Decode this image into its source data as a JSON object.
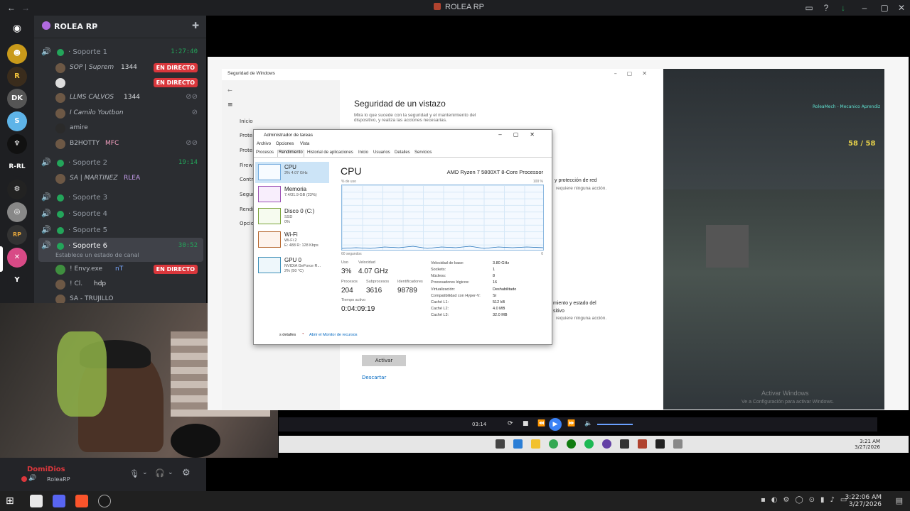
{
  "app": {
    "title": "ROLEA RP"
  },
  "server": {
    "name": "ROLEA RP"
  },
  "channels": [
    {
      "name": "Soporte",
      "sub": "1",
      "time": "1:27:40"
    },
    {
      "name": "Soporte",
      "sub": "2",
      "time": "19:14"
    },
    {
      "name": "Soporte",
      "sub": "3"
    },
    {
      "name": "Soporte",
      "sub": "4"
    },
    {
      "name": "Soporte",
      "sub": "5"
    },
    {
      "name": "Soporte",
      "sub": "6",
      "time": "30:52",
      "status_placeholder": "Establece un estado de canal"
    }
  ],
  "members": [
    {
      "name": "SOP | Suprem",
      "badge": "1344",
      "live": "EN DIRECTO"
    },
    {
      "name": "",
      "live": "EN DIRECTO"
    },
    {
      "name": "LLMS CALVOS",
      "badge": "1344"
    },
    {
      "name": "I Camilo Youtbon"
    },
    {
      "name": "amire"
    },
    {
      "name": "B2HOTTY",
      "badge": "MFC"
    },
    {
      "name": "SA | MARTINEZ",
      "badge": "RLEA"
    },
    {
      "name": "! Envy.exe",
      "badge": "nT",
      "live": "EN DIRECTO"
    },
    {
      "name": "! Cl.",
      "badge": "hdp"
    },
    {
      "name": "SA - TRUJILLO"
    }
  ],
  "user": {
    "name": "DomiDios",
    "status": "RoleaRP"
  },
  "security": {
    "window_title": "Seguridad de Windows",
    "heading": "Seguridad de un vistazo",
    "description": "Mira lo que sucede con la seguridad y el mantenimiento del dispositivo, y realiza las acciones necesarias.",
    "nav": [
      "Inicio",
      "Prote",
      "Prote",
      "Firew",
      "Contr",
      "Segur",
      "Rendi",
      "Opcio"
    ],
    "card1": "y protección de red",
    "card1_sub": "requiere ninguna acción.",
    "card2": "miento y estado del",
    "card2b": "sitivo",
    "card2_sub": "requiere ninguna acción.",
    "activate_btn": "Activar",
    "dismiss_link": "Descartar"
  },
  "taskmgr": {
    "title": "Administrador de tareas",
    "menu": [
      "Archivo",
      "Opciones",
      "Vista"
    ],
    "tabs": [
      "Procesos",
      "Rendimiento",
      "Historial de aplicaciones",
      "Inicio",
      "Usuarios",
      "Detalles",
      "Servicios"
    ],
    "sidebar": [
      {
        "name": "CPU",
        "sub": "3% 4.07 GHz"
      },
      {
        "name": "Memoria",
        "sub": "7.4/31.9 GB (23%)"
      },
      {
        "name": "Disco 0 (C:)",
        "sub": "SSD",
        "sub2": "0%"
      },
      {
        "name": "Wi-Fi",
        "sub": "Wi-Fi 2",
        "sub2": "E: 488 R: 128 Kbps"
      },
      {
        "name": "GPU 0",
        "sub": "NVIDIA GeForce R...",
        "sub2": "2% (50 °C)"
      }
    ],
    "cpu_heading": "CPU",
    "cpu_model": "AMD Ryzen 7 5800XT 8-Core Processor",
    "graph_label": "% de uso",
    "graph_max": "100 %",
    "graph_time": "60 segundos",
    "graph_min": "0",
    "stats": {
      "uso_label": "Uso",
      "uso": "3%",
      "vel_label": "Velocidad",
      "vel": "4.07 GHz",
      "proc_label": "Procesos",
      "proc": "204",
      "sub_label": "Subprocesos",
      "sub": "3616",
      "id_label": "Identificadores",
      "id": "98789",
      "up_label": "Tiempo activo",
      "up": "0:04:09:19"
    },
    "specs": [
      {
        "k": "Velocidad de base:",
        "v": "3.80 GHz"
      },
      {
        "k": "Sockets:",
        "v": "1"
      },
      {
        "k": "Núcleos:",
        "v": "8"
      },
      {
        "k": "Procesadores lógicos:",
        "v": "16"
      },
      {
        "k": "Virtualización:",
        "v": "Deshabilitado"
      },
      {
        "k": "Compatibilidad con Hyper-V:",
        "v": "Sí"
      },
      {
        "k": "Caché L1:",
        "v": "512 kB"
      },
      {
        "k": "Caché L2:",
        "v": "4.0 MB"
      },
      {
        "k": "Caché L3:",
        "v": "32.0 MB"
      }
    ],
    "footer_details": "s detalles",
    "footer_monitor": "Abrir el Monitor de recursos"
  },
  "media": {
    "time": "03:14"
  },
  "watermark": {
    "line1": "Activar Windows",
    "line2": "Ve a Configuración para activar Windows."
  },
  "inner_clock": {
    "time": "3:21 AM",
    "date": "3/27/2026"
  },
  "clock": {
    "time": "3:22:06 AM",
    "date": "3/27/2026"
  },
  "game_hud": {
    "ammo": "58 / 58",
    "char": "RoleaMech - Mecanico Aprendiz"
  },
  "colors": {
    "live": "#da373c",
    "online": "#23a55a",
    "accent": "#5865f2"
  }
}
